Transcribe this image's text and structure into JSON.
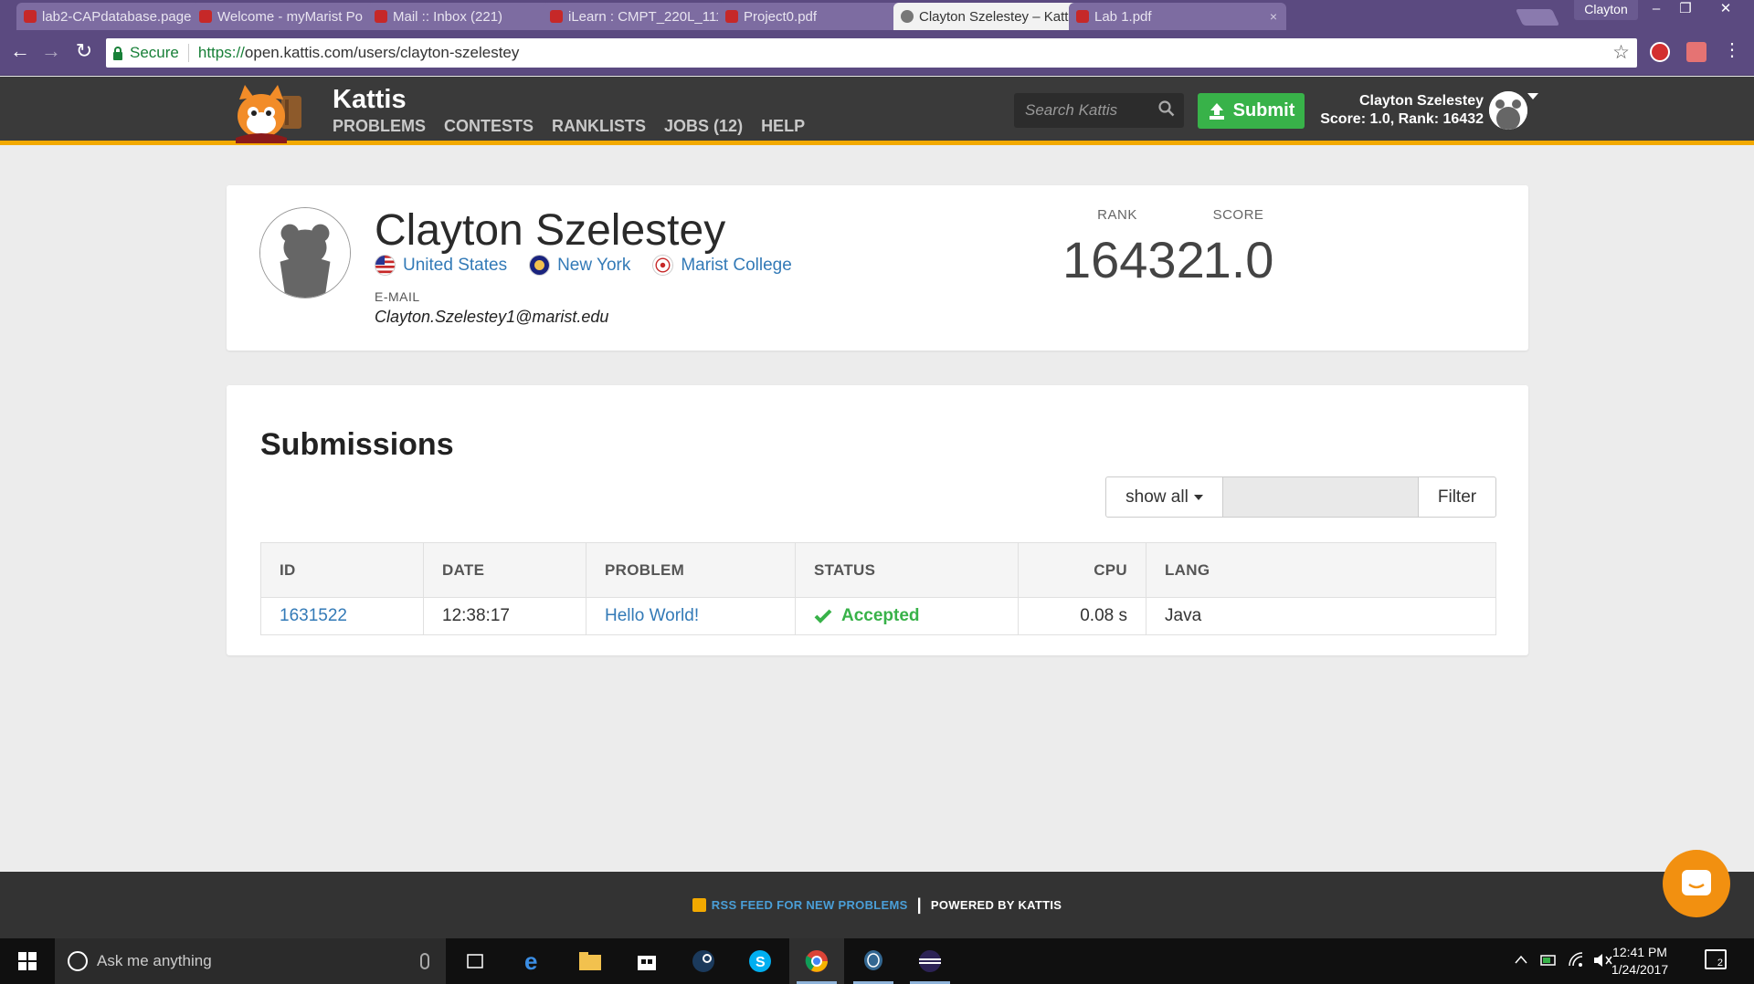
{
  "browser": {
    "tabs": [
      {
        "title": "lab2-CAPdatabase.page",
        "active": false
      },
      {
        "title": "Welcome - myMarist Po",
        "active": false
      },
      {
        "title": "Mail :: Inbox (221)",
        "active": false
      },
      {
        "title": "iLearn : CMPT_220L_111",
        "active": false
      },
      {
        "title": "Project0.pdf",
        "active": false
      },
      {
        "title": "Clayton Szelestey – Katt",
        "active": true
      },
      {
        "title": "Lab 1.pdf",
        "active": false
      }
    ],
    "tab_close": "×",
    "profile_name": "Clayton",
    "window_controls": {
      "minimize": "–",
      "restore": "❐",
      "close": "✕"
    },
    "nav": {
      "back": "←",
      "forward": "→",
      "reload": "↻"
    },
    "secure_label": "Secure",
    "url_protocol": "https://",
    "url_rest": "open.kattis.com/users/clayton-szelestey",
    "bookmark_star": "☆"
  },
  "header": {
    "brand": "Kattis",
    "nav": [
      {
        "label": "PROBLEMS"
      },
      {
        "label": "CONTESTS"
      },
      {
        "label": "RANKLISTS"
      },
      {
        "label": "JOBS (12)"
      },
      {
        "label": "HELP"
      }
    ],
    "search_placeholder": "Search Kattis",
    "submit_label": "Submit",
    "user_name": "Clayton Szelestey",
    "user_stats": "Score: 1.0, Rank: 16432"
  },
  "profile": {
    "name": "Clayton Szelestey",
    "country": "United States",
    "region": "New York",
    "school": "Marist College",
    "email_label": "E-MAIL",
    "email": "Clayton.Szelestey1@marist.edu",
    "rank_label": "RANK",
    "rank": "16432",
    "score_label": "SCORE",
    "score": "1.0"
  },
  "submissions": {
    "title": "Submissions",
    "filter_select": "show all",
    "filter_input_value": "",
    "filter_button": "Filter",
    "columns": [
      "ID",
      "DATE",
      "PROBLEM",
      "STATUS",
      "CPU",
      "LANG"
    ],
    "rows": [
      {
        "id": "1631522",
        "date": "12:38:17",
        "problem": "Hello World!",
        "status": "Accepted",
        "cpu": "0.08 s",
        "lang": "Java"
      }
    ]
  },
  "footer": {
    "rss_label": "RSS FEED FOR NEW PROBLEMS",
    "separator": "|",
    "powered_label": "POWERED BY KATTIS"
  },
  "taskbar": {
    "search_placeholder": "Ask me anything",
    "time": "12:41 PM",
    "date": "1/24/2017",
    "notification_count": "2"
  },
  "colors": {
    "chrome_purple": "#5b4a80",
    "kattis_header": "#3a3a3a",
    "kattis_accent": "#f2a900",
    "submit_green": "#38b249",
    "link_blue": "#337ab7",
    "accepted_green": "#38b249"
  }
}
